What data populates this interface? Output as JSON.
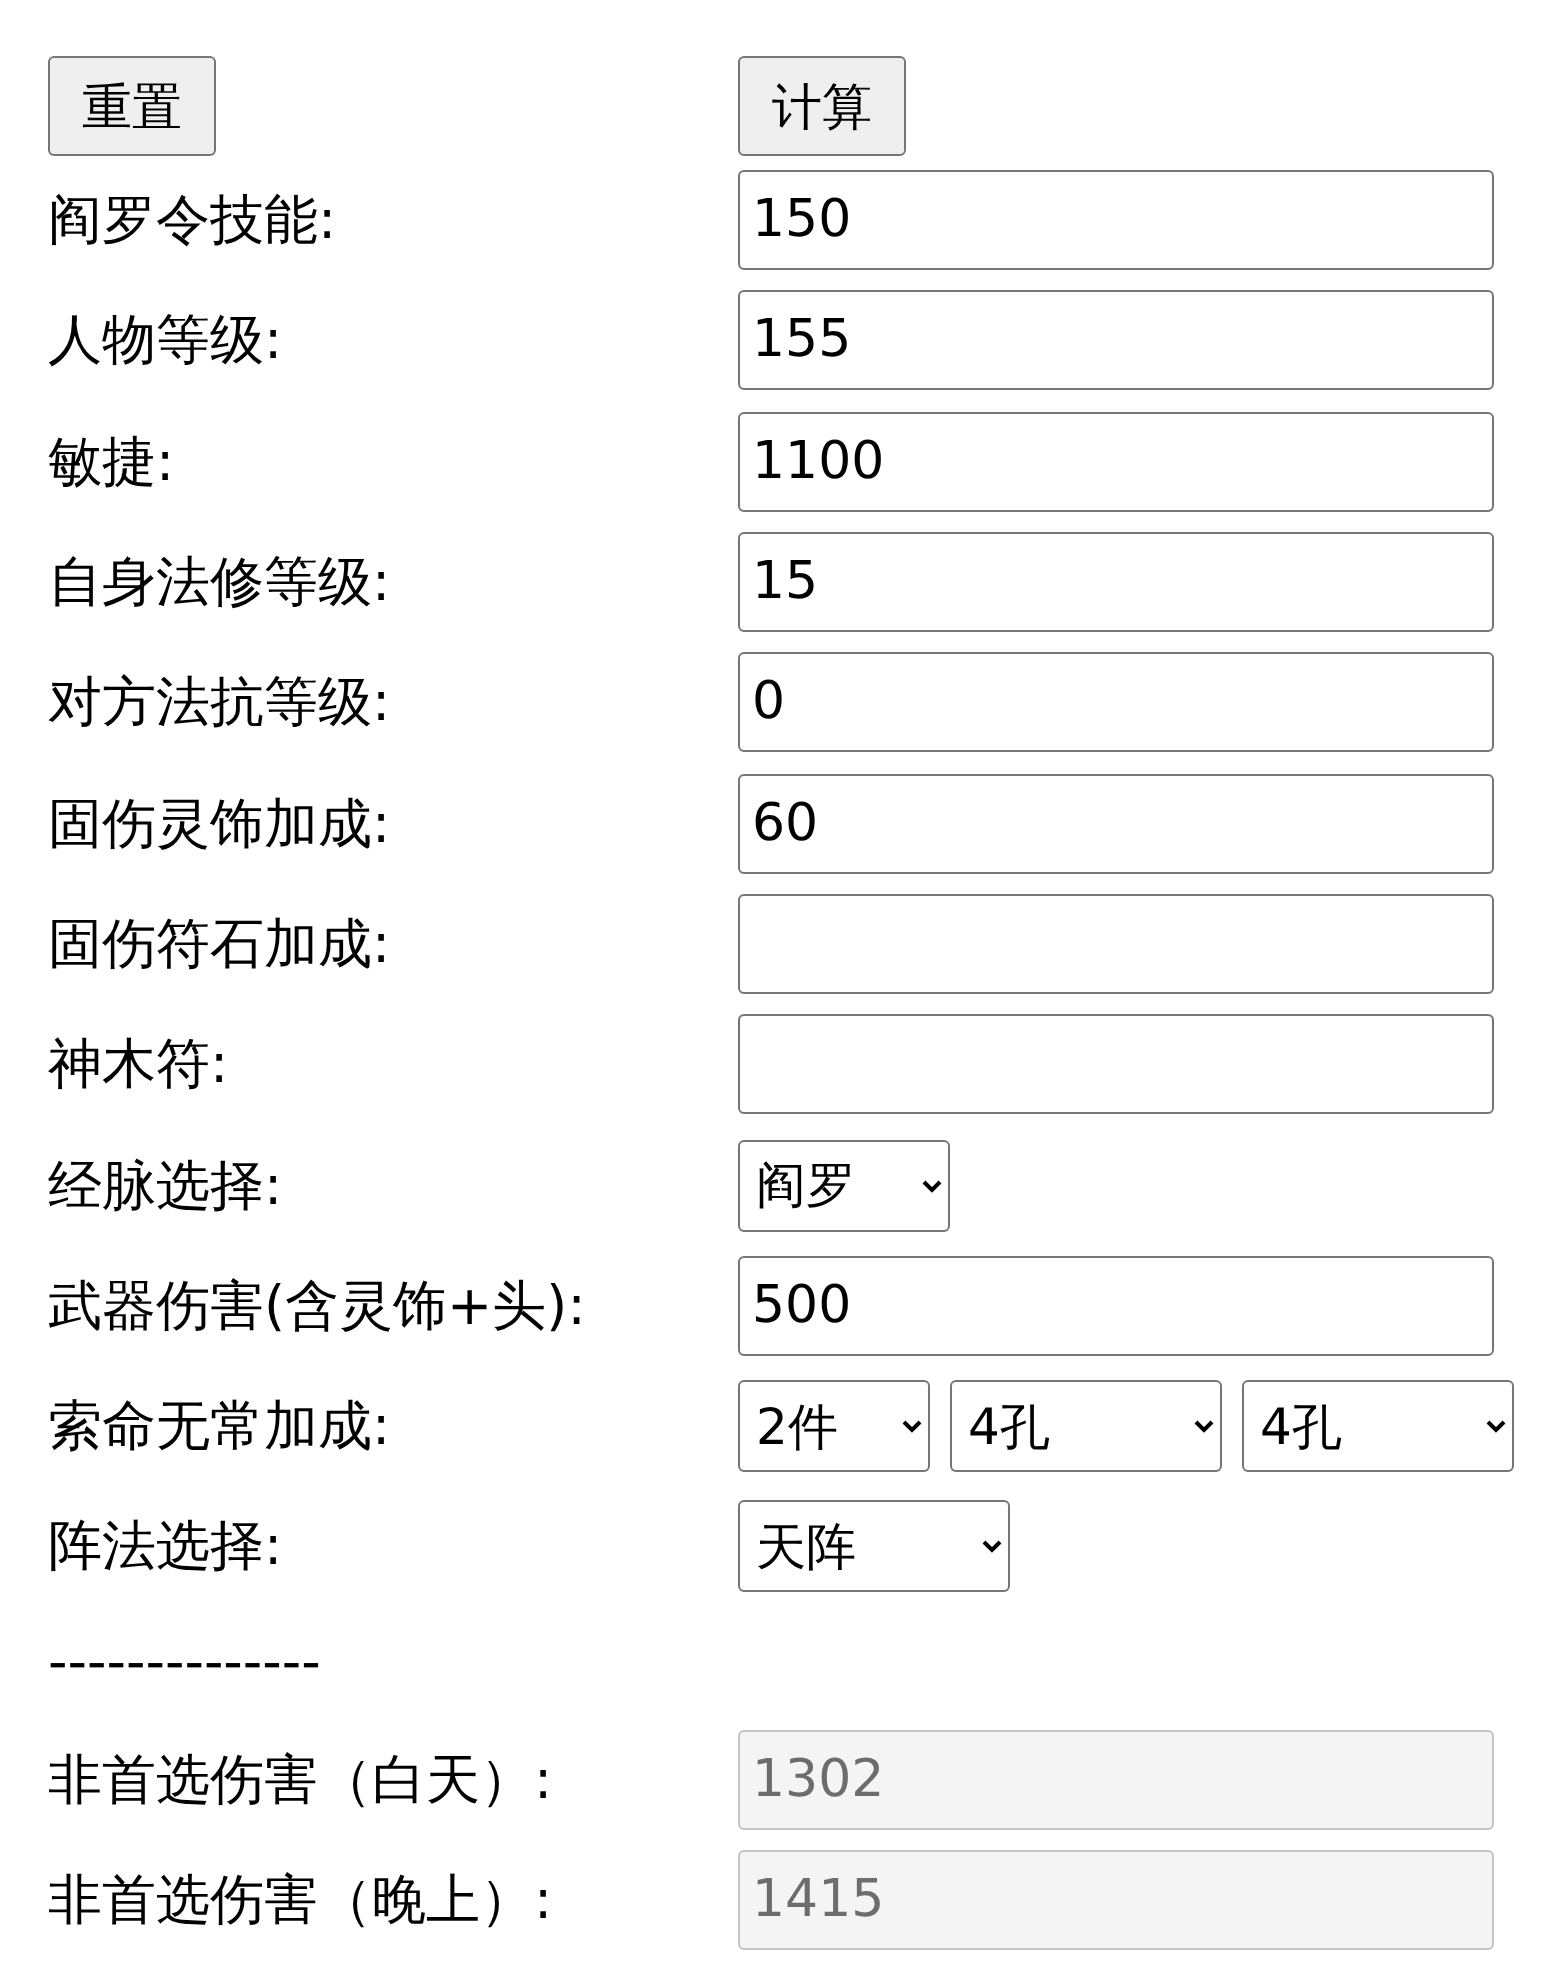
{
  "buttons": [
    {
      "label": "重置"
    },
    {
      "label": "计算"
    }
  ],
  "rows": [
    {
      "label": "阎罗令技能:",
      "kind": "input",
      "value": "150",
      "disabled": false
    },
    {
      "label": "人物等级:",
      "kind": "input",
      "value": "155",
      "disabled": false
    },
    {
      "label": "敏捷:",
      "kind": "input",
      "value": "1100",
      "disabled": false
    },
    {
      "label": "自身法修等级:",
      "kind": "input",
      "value": "15",
      "disabled": false
    },
    {
      "label": "对方法抗等级:",
      "kind": "input",
      "value": "0",
      "disabled": false
    },
    {
      "label": "固伤灵饰加成:",
      "kind": "input",
      "value": "60",
      "disabled": false
    },
    {
      "label": "固伤符石加成:",
      "kind": "input",
      "value": "",
      "disabled": false
    },
    {
      "label": "神木符:",
      "kind": "input",
      "value": "",
      "disabled": false
    },
    {
      "label": "经脉选择:",
      "kind": "select",
      "options": [
        "阎罗"
      ]
    },
    {
      "label": "武器伤害(含灵饰+头):",
      "kind": "input",
      "value": "500",
      "disabled": false
    },
    {
      "label": "索命无常加成:",
      "kind": "select",
      "options": [
        "2件",
        "4孔",
        "4孔"
      ]
    },
    {
      "label": "阵法选择:",
      "kind": "select",
      "options": [
        "天阵"
      ]
    }
  ],
  "separator": "--------------",
  "results": [
    {
      "label": "非首选伤害（白天）:",
      "value": "1302",
      "disabled": true
    },
    {
      "label": "非首选伤害（晚上）:",
      "value": "1415",
      "disabled": true
    }
  ]
}
